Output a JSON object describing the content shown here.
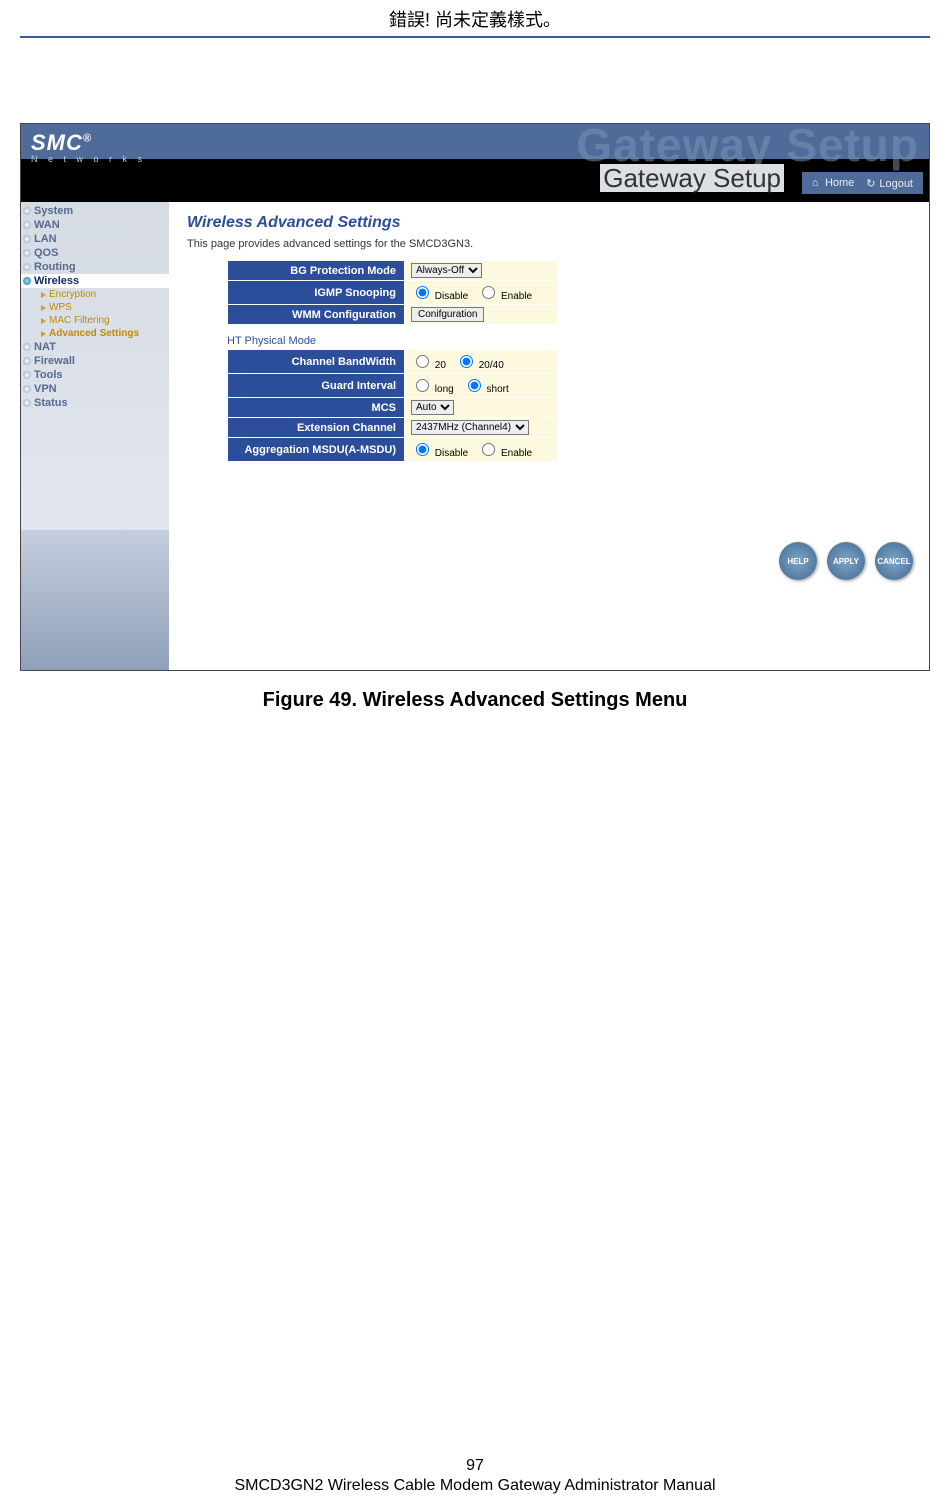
{
  "doc": {
    "top_error": "錯誤! 尚未定義樣式。",
    "figure_caption": "Figure 49. Wireless Advanced Settings Menu",
    "page_number": "97",
    "footer": "SMCD3GN2 Wireless Cable Modem Gateway Administrator Manual"
  },
  "ui": {
    "brand": "SMC",
    "brand_reg": "®",
    "brand_sub": "N e t w o r k s",
    "watermark": "Gateway Setup",
    "gateway_setup": "Gateway Setup",
    "topnav": {
      "home": "Home",
      "logout": "Logout"
    },
    "sidebar": {
      "items": [
        {
          "label": "System",
          "active": false
        },
        {
          "label": "WAN",
          "active": false
        },
        {
          "label": "LAN",
          "active": false
        },
        {
          "label": "QOS",
          "active": false
        },
        {
          "label": "Routing",
          "active": false
        },
        {
          "label": "Wireless",
          "active": true
        },
        {
          "label": "NAT",
          "active": false
        },
        {
          "label": "Firewall",
          "active": false
        },
        {
          "label": "Tools",
          "active": false
        },
        {
          "label": "VPN",
          "active": false
        },
        {
          "label": "Status",
          "active": false
        }
      ],
      "wireless_sub": [
        {
          "label": "Encryption"
        },
        {
          "label": "WPS"
        },
        {
          "label": "MAC Filtering"
        },
        {
          "label": "Advanced Settings"
        }
      ]
    },
    "main": {
      "title": "Wireless Advanced Settings",
      "desc": "This page provides advanced settings for the SMCD3GN3.",
      "section1": [
        {
          "label": "BG Protection Mode",
          "type": "select",
          "value": "Always-Off"
        },
        {
          "label": "IGMP Snooping",
          "type": "radio2",
          "opt1": "Disable",
          "opt2": "Enable",
          "selected": "Disable"
        },
        {
          "label": "WMM Configuration",
          "type": "button",
          "value": "Conifguration"
        }
      ],
      "section2_title": "HT Physical Mode",
      "section2": [
        {
          "label": "Channel BandWidth",
          "type": "radio2",
          "opt1": "20",
          "opt2": "20/40",
          "selected": "20/40"
        },
        {
          "label": "Guard Interval",
          "type": "radio2",
          "opt1": "long",
          "opt2": "short",
          "selected": "short"
        },
        {
          "label": "MCS",
          "type": "select",
          "value": "Auto"
        },
        {
          "label": "Extension Channel",
          "type": "select",
          "value": "2437MHz (Channel4)"
        },
        {
          "label": "Aggregation MSDU(A-MSDU)",
          "type": "radio2",
          "opt1": "Disable",
          "opt2": "Enable",
          "selected": "Disable"
        }
      ],
      "actions": {
        "help": "HELP",
        "apply": "APPLY",
        "cancel": "CANCEL"
      }
    }
  }
}
